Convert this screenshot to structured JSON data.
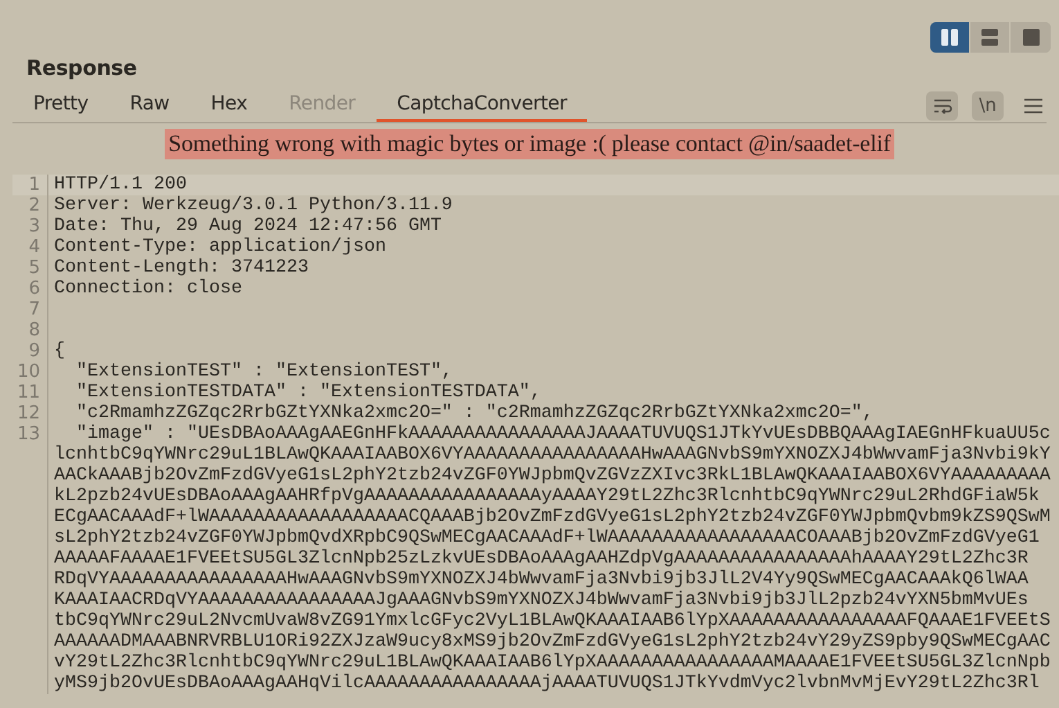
{
  "layout_toggles": [
    {
      "kind": "columns",
      "selected": true
    },
    {
      "kind": "rows",
      "selected": false
    },
    {
      "kind": "single",
      "selected": false
    }
  ],
  "panel": {
    "title": "Response"
  },
  "tabs": [
    {
      "label": "Pretty",
      "selected": false,
      "disabled": false
    },
    {
      "label": "Raw",
      "selected": false,
      "disabled": false
    },
    {
      "label": "Hex",
      "selected": false,
      "disabled": false
    },
    {
      "label": "Render",
      "selected": false,
      "disabled": true
    },
    {
      "label": "CaptchaConverter",
      "selected": true,
      "disabled": false
    }
  ],
  "toolbar": {
    "wrap_on": true,
    "newline_label": "\\n"
  },
  "error_banner": "Something wrong with magic bytes or image :( please contact @in/saadet-elif",
  "lines": [
    {
      "number": "1",
      "text": "HTTP/1.1 200"
    },
    {
      "number": "2",
      "text": "Server: Werkzeug/3.0.1 Python/3.11.9"
    },
    {
      "number": "3",
      "text": "Date: Thu, 29 Aug 2024 12:47:56 GMT"
    },
    {
      "number": "4",
      "text": "Content-Type: application/json"
    },
    {
      "number": "5",
      "text": "Content-Length: 3741223"
    },
    {
      "number": "6",
      "text": "Connection: close"
    },
    {
      "number": "7"
    },
    {
      "number": "8"
    },
    {
      "number": "9",
      "text": "{"
    },
    {
      "number": "10",
      "text": "  \"ExtensionTEST\" : \"ExtensionTEST\","
    },
    {
      "number": "11",
      "text": "  \"ExtensionTESTDATA\" : \"ExtensionTESTDATA\","
    },
    {
      "number": "12",
      "text": "  \"c2RmamhzZGZqc2RrbGZtYXNka2xmc2O=\" : \"c2RmamhzZGZqc2RrbGZtYXNka2xmc2O=\","
    },
    {
      "number": "13",
      "text": "  \"image\" : \"UEsDBAoAAAgAAEGnHFkAAAAAAAAAAAAAAAAJAAAATUVUQS1JTkYvUEsDBBQAAAgIAEGnHFkuaUU5c",
      "continuation": [
        "lcnhtbC9qYWNrc29uL1BLAwQKAAAIAABOX6VYAAAAAAAAAAAAAAAAHwAAAGNvbS9mYXNOZXJ4bWwvamFja3Nvbi9kY",
        "AACkAAABjb2OvZmFzdGVyeG1sL2phY2tzb24vZGF0YWJpbmQvZGVzZXIvc3RkL1BLAwQKAAAIAABOX6VYAAAAAAAAA",
        "kL2pzb24vUEsDBAoAAAgAAHRfpVgAAAAAAAAAAAAAAAAyAAAAY29tL2Zhc3RlcnhtbC9qYWNrc29uL2RhdGFiaW5k",
        "ECgAACAAAdF+lWAAAAAAAAAAAAAAAAAACQAAABjb2OvZmFzdGVyeG1sL2phY2tzb24vZGF0YWJpbmQvbm9kZS9QSwM",
        "sL2phY2tzb24vZGF0YWJpbmQvdXRpbC9QSwMECgAACAAAdF+lWAAAAAAAAAAAAAAAAACOAAABjb2OvZmFzdGVyeG1",
        "AAAAAFAAAAE1FVEEtSU5GL3ZlcnNpb25zLzkvUEsDBAoAAAgAAHZdpVgAAAAAAAAAAAAAAAAhAAAAY29tL2Zhc3R",
        "RDqVYAAAAAAAAAAAAAAAAHwAAAGNvbS9mYXNOZXJ4bWwvamFja3Nvbi9jb3JlL2V4Yy9QSwMECgAACAAAkQ6lWAA",
        "KAAAIAACRDqVYAAAAAAAAAAAAAAAAJgAAAGNvbS9mYXNOZXJ4bWwvamFja3Nvbi9jb3JlL2pzb24vYXN5bmMvUEs",
        "tbC9qYWNrc29uL2NvcmUvaW8vZG91YmxlcGFyc2VyL1BLAwQKAAAIAAB6lYpXAAAAAAAAAAAAAAAAFQAAAE1FVEEtS",
        "AAAAAADMAAABNRVRBLU1ORi92ZXJzaW9ucy8xMS9jb2OvZmFzdGVyeG1sL2phY2tzb24vY29yZS9pby9QSwMECgAAC",
        "vY29tL2Zhc3RlcnhtbC9qYWNrc29uL1BLAwQKAAAIAAB6lYpXAAAAAAAAAAAAAAAAMAAAAE1FVEEtSU5GL3ZlcnNpb",
        "yMS9jb2OvUEsDBAoAAAgAAHqVilcAAAAAAAAAAAAAAAAjAAAATUVUQS1JTkYvdmVyc2lvbnMvMjEvY29tL2Zhc3Rl"
      ]
    }
  ]
}
